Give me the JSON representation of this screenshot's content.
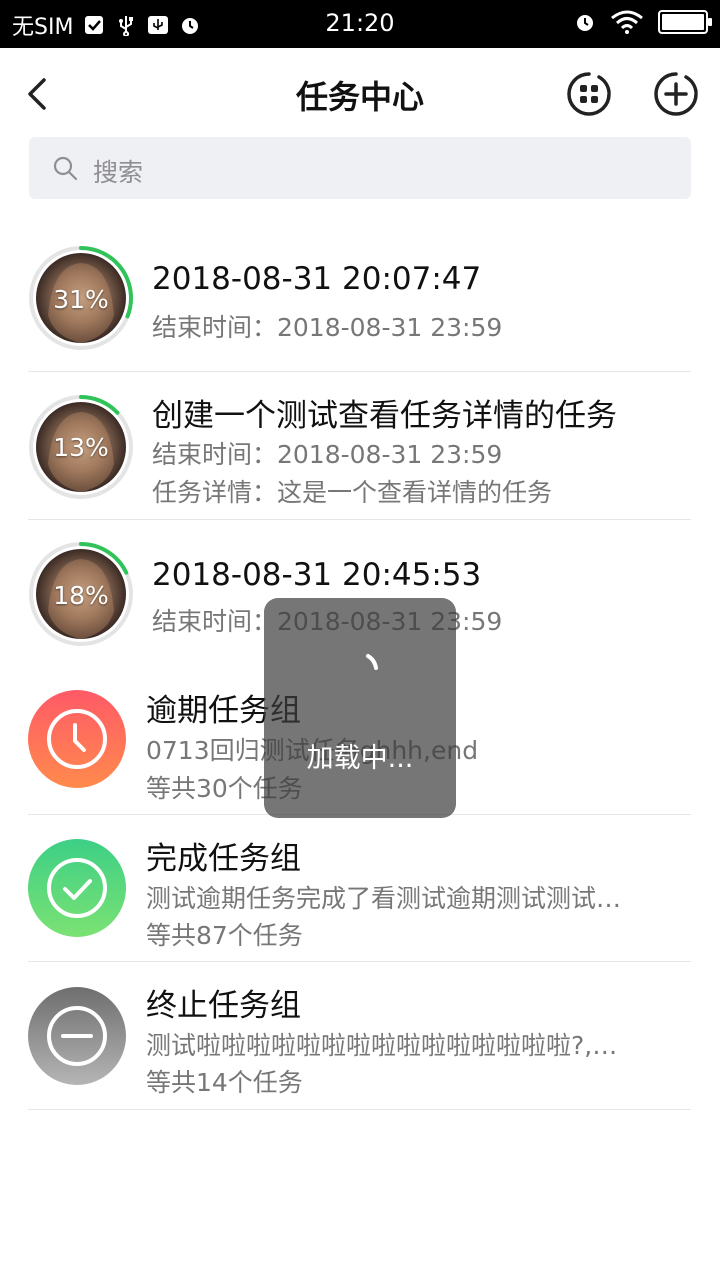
{
  "status_bar": {
    "carrier": "无SIM",
    "time": "21:20"
  },
  "nav": {
    "title": "任务中心",
    "back_icon": "chevron-left-icon",
    "grid_icon": "grid-icon",
    "add_icon": "plus-circle-icon"
  },
  "search": {
    "placeholder": "搜索"
  },
  "tasks": [
    {
      "title": "2018-08-31 20:07:47",
      "progress_label": "31%",
      "progress": 0.31,
      "end_time": "结束时间：2018-08-31 23:59",
      "detail": ""
    },
    {
      "title": "创建一个测试查看任务详情的任务",
      "progress_label": "13%",
      "progress": 0.13,
      "end_time": "结束时间：2018-08-31 23:59",
      "detail": "任务详情：这是一个查看详情的任务"
    },
    {
      "title": "2018-08-31 20:45:53",
      "progress_label": "18%",
      "progress": 0.18,
      "end_time": "结束时间：2018-08-31 23:59",
      "detail": ""
    }
  ],
  "groups": [
    {
      "title": "逾期任务组",
      "desc": "0713回归测试任务ghhh,end",
      "count": "等共30个任务",
      "icon": "clock-icon",
      "color_top": "#ff5a67",
      "color_bottom": "#ff8a4c"
    },
    {
      "title": "完成任务组",
      "desc": "测试逾期任务完成了看测试逾期测试测试…",
      "count": "等共87个任务",
      "icon": "check-icon",
      "color_top": "#3dcf86",
      "color_bottom": "#7be273"
    },
    {
      "title": "终止任务组",
      "desc": "测试啦啦啦啦啦啦啦啦啦啦啦啦啦啦啦?,…",
      "count": "等共14个任务",
      "icon": "minus-icon",
      "color_top": "#6e6e6e",
      "color_bottom": "#b5b5b5"
    }
  ],
  "loading": {
    "text": "加载中..."
  },
  "colors": {
    "progress": "#2fc35a",
    "ring_track": "#e4e4e4"
  }
}
